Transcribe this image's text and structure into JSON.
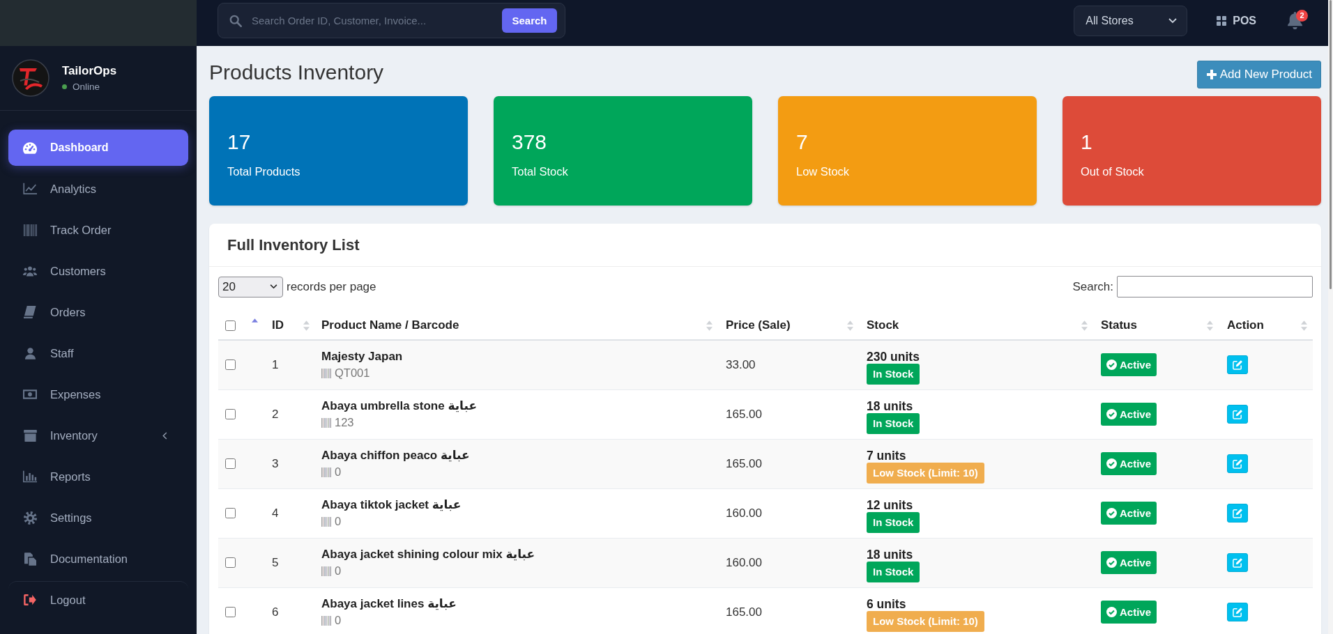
{
  "sidebar": {
    "brand": "TailorOps",
    "status": "Online",
    "menu": [
      {
        "label": "Dashboard",
        "kind": "link",
        "selected": true
      },
      {
        "label": "Analytics",
        "kind": "link",
        "selected": false
      },
      {
        "label": "Track Order",
        "kind": "link",
        "selected": false
      },
      {
        "label": "Customers",
        "kind": "link",
        "selected": false
      },
      {
        "label": "Orders",
        "kind": "link",
        "selected": false
      },
      {
        "label": "Staff",
        "kind": "link",
        "selected": false
      },
      {
        "label": "Expenses",
        "kind": "link",
        "selected": false
      },
      {
        "label": "Inventory",
        "kind": "submenu",
        "selected": false,
        "expanded": false
      },
      {
        "label": "Reports",
        "kind": "link",
        "selected": false
      },
      {
        "label": "Settings",
        "kind": "link",
        "selected": false
      },
      {
        "label": "Documentation",
        "kind": "link",
        "selected": false
      }
    ],
    "logout": {
      "label": "Logout"
    }
  },
  "topbar": {
    "search": {
      "placeholder": "Search Order ID, Customer, Invoice...",
      "button": "Search"
    },
    "store_select": {
      "value": "All Stores"
    },
    "pos": {
      "label": "POS"
    },
    "notifications": {
      "count": "2"
    }
  },
  "page": {
    "title": "Products Inventory",
    "add_button": "Add New Product"
  },
  "stats": [
    {
      "value": "17",
      "label": "Total Products",
      "color": "#0073b7"
    },
    {
      "value": "378",
      "label": "Total Stock",
      "color": "#00a65a"
    },
    {
      "value": "7",
      "label": "Low Stock",
      "color": "#f39c12"
    },
    {
      "value": "1",
      "label": "Out of Stock",
      "color": "#dd4b39"
    }
  ],
  "inventory": {
    "title": "Full Inventory List",
    "page_size": "20",
    "page_size_label": "records per page",
    "search_label": "Search:",
    "columns": [
      {
        "kind": "checkbox",
        "checked": false,
        "sorted": true
      },
      {
        "kind": "text",
        "label": "ID",
        "sorted": false
      },
      {
        "kind": "text",
        "label": "Product Name / Barcode",
        "sorted": false
      },
      {
        "kind": "text",
        "label": "Price (Sale)",
        "sorted": false
      },
      {
        "kind": "text",
        "label": "Stock",
        "sorted": false
      },
      {
        "kind": "text",
        "label": "Status",
        "sorted": false
      },
      {
        "kind": "text",
        "label": "Action",
        "sorted": false
      }
    ],
    "rows": [
      {
        "checked": false,
        "id": "1",
        "name": "Majesty Japan",
        "barcode": "QT001",
        "price": "33.00",
        "stock": {
          "units": "230 units",
          "badge": "In Stock",
          "kind": "ok"
        },
        "status": {
          "label": "Active",
          "kind": "active"
        }
      },
      {
        "checked": false,
        "id": "2",
        "name": "Abaya umbrella stone عباية",
        "barcode": "123",
        "price": "165.00",
        "stock": {
          "units": "18 units",
          "badge": "In Stock",
          "kind": "ok"
        },
        "status": {
          "label": "Active",
          "kind": "active"
        }
      },
      {
        "checked": false,
        "id": "3",
        "name": "Abaya chiffon peaco عباية",
        "barcode": "0",
        "price": "165.00",
        "stock": {
          "units": "7 units",
          "badge": "Low Stock (Limit: 10)",
          "kind": "low"
        },
        "status": {
          "label": "Active",
          "kind": "active"
        }
      },
      {
        "checked": false,
        "id": "4",
        "name": "Abaya tiktok jacket عباية",
        "barcode": "0",
        "price": "160.00",
        "stock": {
          "units": "12 units",
          "badge": "In Stock",
          "kind": "ok"
        },
        "status": {
          "label": "Active",
          "kind": "active"
        }
      },
      {
        "checked": false,
        "id": "5",
        "name": "Abaya jacket shining colour mix عباية",
        "barcode": "0",
        "price": "160.00",
        "stock": {
          "units": "18 units",
          "badge": "In Stock",
          "kind": "ok"
        },
        "status": {
          "label": "Active",
          "kind": "active"
        }
      },
      {
        "checked": false,
        "id": "6",
        "name": "Abaya jacket lines عباية",
        "barcode": "0",
        "price": "165.00",
        "stock": {
          "units": "6 units",
          "badge": "Low Stock (Limit: 10)",
          "kind": "low"
        },
        "status": {
          "label": "Active",
          "kind": "active"
        }
      }
    ]
  }
}
